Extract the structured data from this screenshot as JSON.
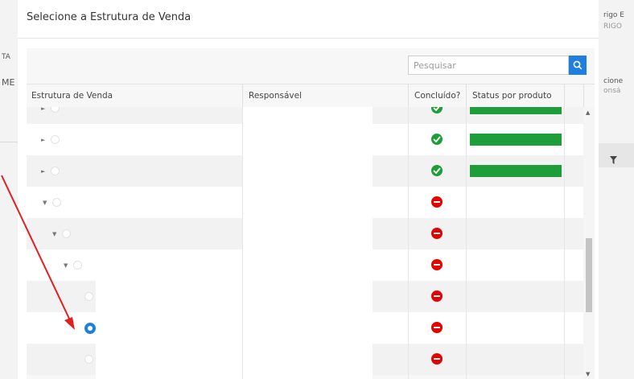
{
  "dialog": {
    "title": "Selecione a Estrutura de Venda",
    "search_placeholder": "Pesquisar"
  },
  "columns": {
    "estrutura": "Estrutura de Venda",
    "responsavel": "Responsável",
    "concluido": "Concluído?",
    "status": "Status por produto"
  },
  "rows": [
    {
      "caret": "►",
      "concluido": "ok",
      "progress": 1.0
    },
    {
      "caret": "►",
      "concluido": "ok",
      "progress": 1.0
    },
    {
      "caret": "►",
      "concluido": "ok",
      "progress": 1.0
    },
    {
      "caret": "▼",
      "concluido": "not",
      "progress": 0
    },
    {
      "caret": "▼",
      "concluido": "not",
      "progress": 0
    },
    {
      "caret": "▼",
      "concluido": "not",
      "progress": 0
    },
    {
      "caret": "",
      "concluido": "not",
      "progress": 0
    },
    {
      "caret": "",
      "concluido": "not",
      "progress": 0,
      "selected": true
    },
    {
      "caret": "",
      "concluido": "not",
      "progress": 0
    }
  ],
  "background": {
    "right_top_1": "rigo E",
    "right_top_2": "RIGO",
    "right_mid_1": "cione",
    "right_mid_2": "onsá",
    "left_1": "TA",
    "left_2": "ME"
  },
  "colors": {
    "accent": "#1e7fe0",
    "success": "#1e9e3b",
    "danger": "#e60000",
    "annotation_arrow": "#e02020"
  }
}
